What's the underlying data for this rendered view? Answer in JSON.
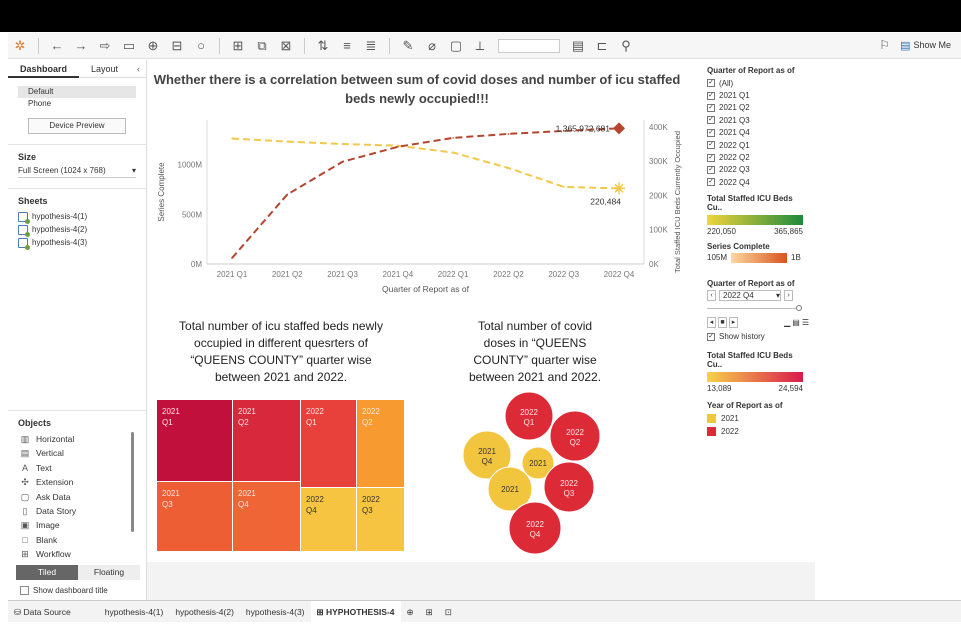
{
  "toolbar": {
    "icons": [
      "tableau-logo-icon",
      "undo-icon",
      "redo-icon",
      "redo-arrow-icon",
      "save-icon",
      "new-datasource-icon",
      "pause-icon",
      "refresh-icon",
      "new-sheet-icon",
      "duplicate-icon",
      "clear-icon",
      "swap-icon",
      "sort-asc-icon",
      "sort-desc-icon",
      "highlight-icon",
      "group-icon",
      "label-icon",
      "fix-axes-icon",
      "fit-icon",
      "presentation-icon",
      "share-icon"
    ],
    "show_me": "Show Me"
  },
  "left_panel": {
    "tab_dashboard": "Dashboard",
    "tab_layout": "Layout",
    "devices": [
      "Default",
      "Phone"
    ],
    "device_preview": "Device Preview",
    "size_heading": "Size",
    "size_value": "Full Screen (1024 x 768)",
    "sheets_heading": "Sheets",
    "sheets": [
      "hypothesis-4(1)",
      "hypothesis-4(2)",
      "hypothesis-4(3)"
    ],
    "objects_heading": "Objects",
    "objects": [
      {
        "label": "Horizontal",
        "icon": "horizontal-icon"
      },
      {
        "label": "Vertical",
        "icon": "vertical-icon"
      },
      {
        "label": "Text",
        "icon": "text-icon"
      },
      {
        "label": "Extension",
        "icon": "extension-icon"
      },
      {
        "label": "Ask Data",
        "icon": "ask-data-icon"
      },
      {
        "label": "Data Story",
        "icon": "data-story-icon"
      },
      {
        "label": "Image",
        "icon": "image-icon"
      },
      {
        "label": "Blank",
        "icon": "blank-icon"
      },
      {
        "label": "Workflow",
        "icon": "workflow-icon"
      }
    ],
    "tiled": "Tiled",
    "floating": "Floating",
    "show_title": "Show dashboard title"
  },
  "dashboard": {
    "title_line1": "Whether there is a correlation between sum of covid doses and number of icu staffed",
    "title_line2": "beds newly occupied!!!",
    "treemap_title": [
      "Total number of icu staffed beds newly",
      "occupied in different quesrters of",
      "“QUEENS COUNTY” quarter wise",
      "between 2021 and 2022."
    ],
    "bubble_title": [
      "Total number of covid",
      "doses in “QUEENS",
      "COUNTY” quarter wise",
      "between 2021 and 2022."
    ]
  },
  "chart_data": [
    {
      "type": "line",
      "categories": [
        "2021 Q1",
        "2021 Q2",
        "2021 Q3",
        "2021 Q4",
        "2022 Q1",
        "2022 Q2",
        "2022 Q3",
        "2022 Q4"
      ],
      "xlabel": "Quarter of Report as of",
      "ylabel_left": "Series Complete",
      "ylabel_right": "Total Staffed ICU Beds Currently Occupied",
      "left_ticks": [
        "0M",
        "500M",
        "1000M"
      ],
      "right_ticks": [
        "0K",
        "100K",
        "200K",
        "300K",
        "400K"
      ],
      "ylim_left": [
        0,
        1450000000
      ],
      "ylim_right": [
        0,
        420000
      ],
      "series": [
        {
          "name": "Series Complete",
          "axis": "left",
          "color": "#b5452e",
          "values": [
            60000000,
            700000000,
            1030000000,
            1180000000,
            1270000000,
            1310000000,
            1340000000,
            1365972681
          ]
        },
        {
          "name": "Total Staffed ICU Beds Currently Occupied",
          "axis": "right",
          "color": "#f2c84b",
          "values": [
            365865,
            357000,
            350000,
            345000,
            325000,
            280000,
            225000,
            220484
          ]
        }
      ],
      "labels": {
        "series_complete_last": "1,365,972,681",
        "icu_last": "220,484"
      }
    },
    {
      "type": "treemap",
      "cells": [
        {
          "line1": "2021",
          "line2": "Q1",
          "color": "#c2103d"
        },
        {
          "line1": "2021",
          "line2": "Q2",
          "color": "#d8283c"
        },
        {
          "line1": "2022",
          "line2": "Q1",
          "color": "#e8403a"
        },
        {
          "line1": "2022",
          "line2": "Q2",
          "color": "#f79a30"
        },
        {
          "line1": "2021",
          "line2": "Q3",
          "color": "#ee5e35"
        },
        {
          "line1": "2021",
          "line2": "Q4",
          "color": "#ef6535"
        },
        {
          "line1": "2022",
          "line2": "Q4",
          "color": "#f7c442"
        },
        {
          "line1": "2022",
          "line2": "Q3",
          "color": "#f7c442"
        }
      ]
    },
    {
      "type": "bubble",
      "bubbles": [
        {
          "line1": "2022",
          "line2": "Q1",
          "color": "#dd2a37"
        },
        {
          "line1": "2022",
          "line2": "Q2",
          "color": "#dd2a37"
        },
        {
          "line1": "2021",
          "line2": "Q4",
          "color": "#f2c53f"
        },
        {
          "line1": "2021",
          "line2": "",
          "color": "#f2c53f"
        },
        {
          "line1": "2021",
          "line2": "",
          "color": "#f2c53f"
        },
        {
          "line1": "2022",
          "line2": "Q3",
          "color": "#dd2a37"
        },
        {
          "line1": "2022",
          "line2": "Q4",
          "color": "#dd2a37"
        }
      ]
    }
  ],
  "legends": {
    "quarter_filter": {
      "title": "Quarter of Report as of",
      "items": [
        "(All)",
        "2021 Q1",
        "2021 Q2",
        "2021 Q3",
        "2021 Q4",
        "2022 Q1",
        "2022 Q2",
        "2022 Q3",
        "2022 Q4"
      ]
    },
    "icu_gradient": {
      "title": "Total Staffed ICU Beds Cu..",
      "min": "220,050",
      "max": "365,865",
      "from": "#f2d43a",
      "to": "#1e8a3c"
    },
    "series_gradient": {
      "title": "Series Complete",
      "min": "105M",
      "max": "1B",
      "from": "#fbd9a0",
      "to": "#d9531e"
    },
    "quarter_slider": {
      "title": "Quarter of Report as of",
      "value": "2022 Q4",
      "show_history": "Show history"
    },
    "icu_gradient2": {
      "title": "Total Staffed ICU Beds Cu..",
      "min": "13,089",
      "max": "24,594",
      "from": "#f7d24a",
      "to": "#d91a4c"
    },
    "year": {
      "title": "Year of Report as of",
      "items": [
        {
          "label": "2021",
          "color": "#f2c53f"
        },
        {
          "label": "2022",
          "color": "#dd2a37"
        }
      ]
    }
  },
  "bottom_tabs": {
    "data_source": "Data Source",
    "tabs": [
      "hypothesis-4(1)",
      "hypothesis-4(2)",
      "hypothesis-4(3)"
    ],
    "active": "HYPHOTHESIS-4"
  }
}
